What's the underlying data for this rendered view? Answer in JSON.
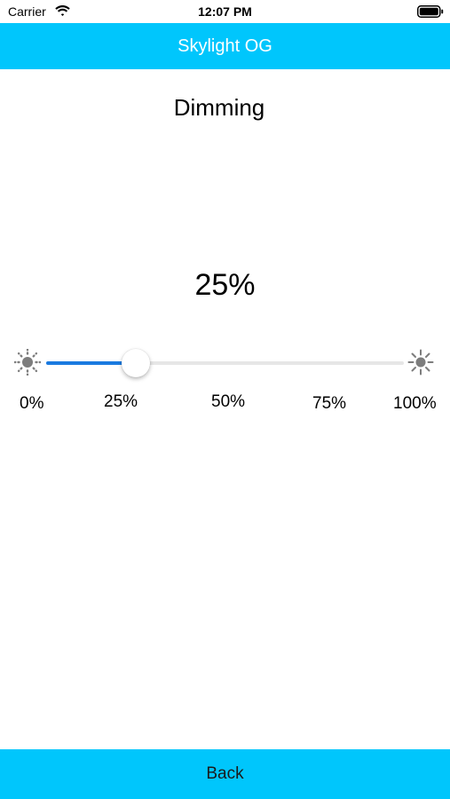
{
  "status_bar": {
    "carrier": "Carrier",
    "time": "12:07 PM"
  },
  "nav": {
    "title": "Skylight OG",
    "background_color": "#00c6fc"
  },
  "dimming": {
    "title": "Dimming",
    "value_text": "25%",
    "level_percent": 25,
    "min_icon": "brightness-low-icon",
    "max_icon": "brightness-high-icon",
    "tick_labels": [
      "0%",
      "25%",
      "50%",
      "75%",
      "100%"
    ],
    "fill_color": "#1a7ae0"
  },
  "footer": {
    "back_label": "Back"
  }
}
